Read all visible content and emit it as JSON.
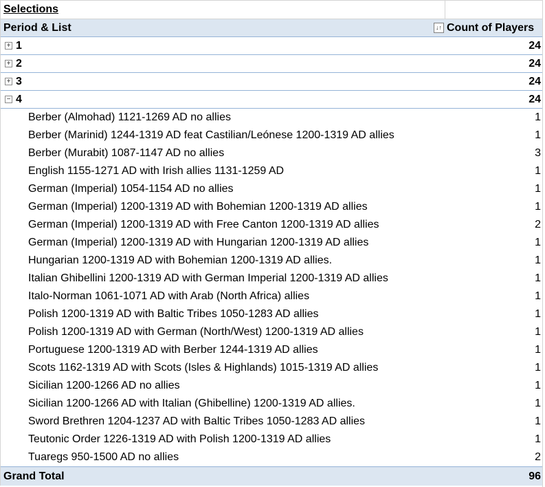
{
  "pivot": {
    "title": "Selections",
    "header": {
      "row_label": "Period & List",
      "value_label": "Count of Players"
    },
    "groups": [
      {
        "label": "1",
        "count": "24",
        "expanded": false
      },
      {
        "label": "2",
        "count": "24",
        "expanded": false
      },
      {
        "label": "3",
        "count": "24",
        "expanded": false
      },
      {
        "label": "4",
        "count": "24",
        "expanded": true
      }
    ],
    "details": [
      {
        "label": "Berber (Almohad) 1121-1269 AD no allies",
        "count": "1"
      },
      {
        "label": "Berber (Marinid) 1244-1319 AD feat Castilian/Leónese 1200-1319 AD allies",
        "count": "1"
      },
      {
        "label": "Berber (Murabit) 1087-1147 AD no allies",
        "count": "3"
      },
      {
        "label": "English 1155-1271 AD with Irish allies 1131-1259 AD",
        "count": "1"
      },
      {
        "label": "German (Imperial) 1054-1154 AD no allies",
        "count": "1"
      },
      {
        "label": "German (Imperial) 1200-1319 AD with Bohemian 1200-1319 AD allies",
        "count": "1"
      },
      {
        "label": "German (Imperial) 1200-1319 AD with Free Canton 1200-1319 AD allies",
        "count": "2"
      },
      {
        "label": "German (Imperial) 1200-1319 AD with Hungarian 1200-1319 AD allies",
        "count": "1"
      },
      {
        "label": "Hungarian 1200-1319 AD with Bohemian 1200-1319 AD allies.",
        "count": "1"
      },
      {
        "label": "Italian Ghibellini 1200-1319 AD with German Imperial 1200-1319 AD allies",
        "count": "1"
      },
      {
        "label": "Italo-Norman 1061-1071 AD with Arab (North Africa) allies",
        "count": "1"
      },
      {
        "label": "Polish 1200-1319 AD with Baltic Tribes 1050-1283 AD allies",
        "count": "1"
      },
      {
        "label": "Polish 1200-1319 AD with German (North/West) 1200-1319 AD allies",
        "count": "1"
      },
      {
        "label": "Portuguese 1200-1319 AD with Berber 1244-1319 AD allies",
        "count": "1"
      },
      {
        "label": "Scots 1162-1319 AD with Scots (Isles & Highlands) 1015-1319 AD allies",
        "count": "1"
      },
      {
        "label": "Sicilian 1200-1266 AD no allies",
        "count": "1"
      },
      {
        "label": "Sicilian 1200-1266 AD with Italian (Ghibelline) 1200-1319 AD allies.",
        "count": "1"
      },
      {
        "label": "Sword Brethren 1204-1237 AD with Baltic Tribes 1050-1283 AD allies",
        "count": "1"
      },
      {
        "label": "Teutonic Order 1226-1319 AD with Polish 1200-1319 AD allies",
        "count": "1"
      },
      {
        "label": "Tuaregs 950-1500 AD no allies",
        "count": "2"
      }
    ],
    "total": {
      "label": "Grand Total",
      "count": "96"
    },
    "icons": {
      "expand": "plus-box-icon",
      "collapse": "minus-box-icon",
      "filter": "sort-filter-icon"
    },
    "colors": {
      "header_bg": "#dce6f1",
      "border": "#95b3d7"
    }
  }
}
